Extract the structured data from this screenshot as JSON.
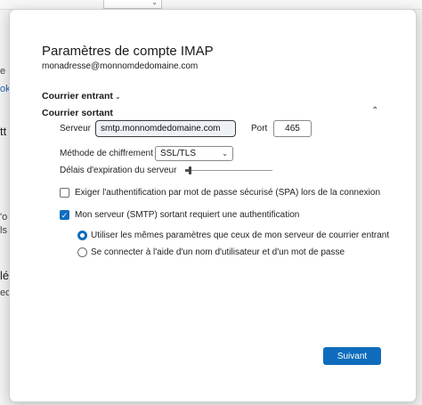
{
  "background": {
    "fragments": [
      "e",
      "ok",
      "tt",
      "'o",
      "ls",
      "lé",
      "ec"
    ]
  },
  "dialog": {
    "title": "Paramètres de compte IMAP",
    "email": "monadresse@monnomdedomaine.com",
    "incoming_label": "Courrier entrant",
    "outgoing_label": "Courrier sortant",
    "server_label": "Serveur",
    "server_value": "smtp.monnomdedomaine.com",
    "port_label": "Port",
    "port_value": "465",
    "encryption_label": "Méthode de chiffrement",
    "encryption_value": "SSL/TLS",
    "timeout_label": "Délais d'expiration du serveur",
    "timeout_level": 0.02,
    "spa_label": "Exiger l'authentification par mot de passe sécurisé (SPA) lors de la connexion",
    "spa_checked": false,
    "smtp_auth_label": "Mon serveur (SMTP) sortant requiert une authentification",
    "smtp_auth_checked": true,
    "radio_same_label": "Utiliser les mêmes paramètres que ceux de mon serveur de courrier entrant",
    "radio_same_selected": true,
    "radio_custom_label": "Se connecter à l'aide d'un nom d'utilisateur et d'un mot de passe",
    "radio_custom_selected": false,
    "next_label": "Suivant"
  },
  "colors": {
    "accent": "#0f6cbd",
    "dialog_bg": "#ffffff",
    "backdrop": "#f3f3f3"
  }
}
